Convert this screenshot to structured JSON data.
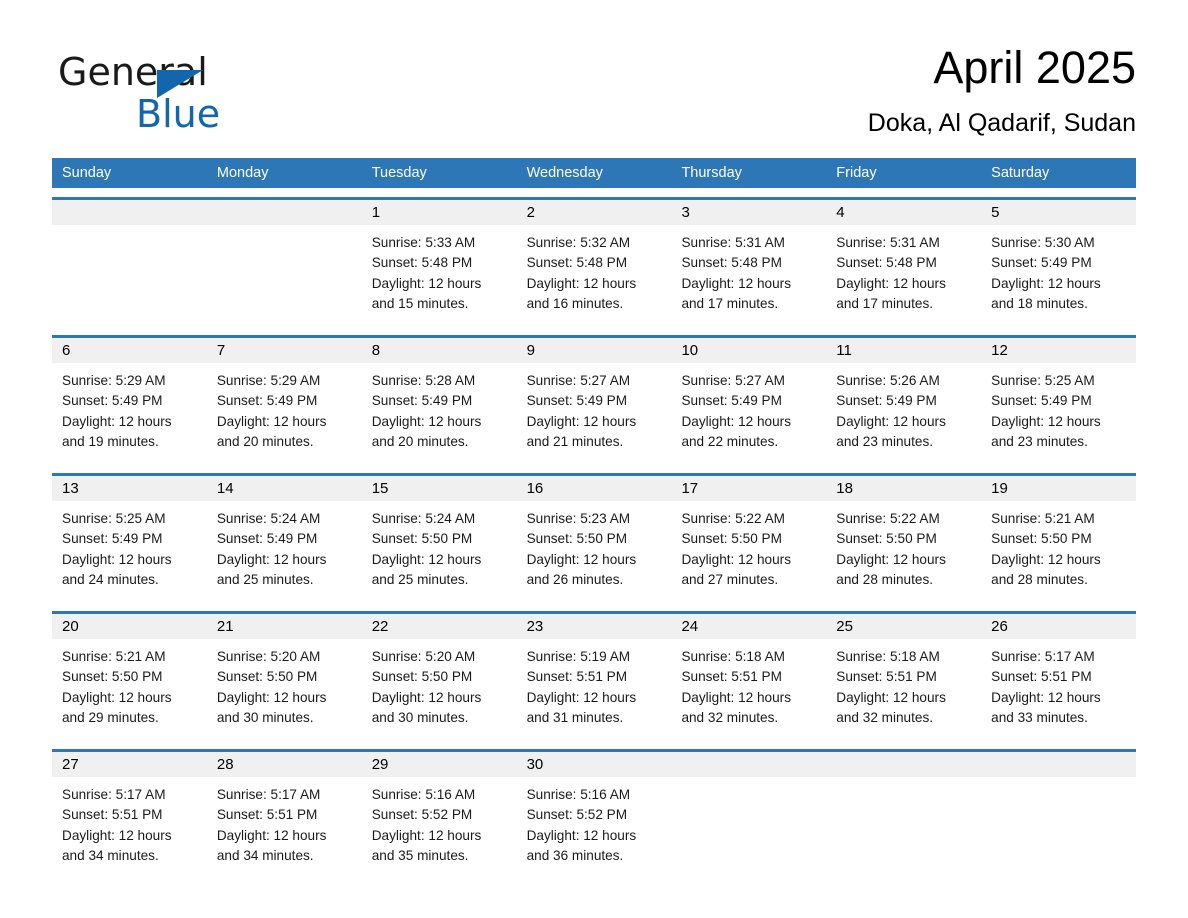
{
  "logo": {
    "word_one": "General",
    "word_two": "Blue",
    "triangle": "triangle-icon",
    "brand_color": "#1266ab"
  },
  "header": {
    "title": "April 2025",
    "subtitle": "Doka, Al Qadarif, Sudan"
  },
  "theme": {
    "header_blue": "#2e77b6",
    "row_divider_blue": "#2e77b6",
    "daynum_band": "#f0f0f0",
    "text": "#1a1a1a"
  },
  "weekdays": [
    "Sunday",
    "Monday",
    "Tuesday",
    "Wednesday",
    "Thursday",
    "Friday",
    "Saturday"
  ],
  "weeks": [
    {
      "days": [
        {
          "num": "",
          "sunrise": "",
          "sunset": "",
          "daylight_1": "",
          "daylight_2": ""
        },
        {
          "num": "",
          "sunrise": "",
          "sunset": "",
          "daylight_1": "",
          "daylight_2": ""
        },
        {
          "num": "1",
          "sunrise": "Sunrise: 5:33 AM",
          "sunset": "Sunset: 5:48 PM",
          "daylight_1": "Daylight: 12 hours",
          "daylight_2": "and 15 minutes."
        },
        {
          "num": "2",
          "sunrise": "Sunrise: 5:32 AM",
          "sunset": "Sunset: 5:48 PM",
          "daylight_1": "Daylight: 12 hours",
          "daylight_2": "and 16 minutes."
        },
        {
          "num": "3",
          "sunrise": "Sunrise: 5:31 AM",
          "sunset": "Sunset: 5:48 PM",
          "daylight_1": "Daylight: 12 hours",
          "daylight_2": "and 17 minutes."
        },
        {
          "num": "4",
          "sunrise": "Sunrise: 5:31 AM",
          "sunset": "Sunset: 5:48 PM",
          "daylight_1": "Daylight: 12 hours",
          "daylight_2": "and 17 minutes."
        },
        {
          "num": "5",
          "sunrise": "Sunrise: 5:30 AM",
          "sunset": "Sunset: 5:49 PM",
          "daylight_1": "Daylight: 12 hours",
          "daylight_2": "and 18 minutes."
        }
      ]
    },
    {
      "days": [
        {
          "num": "6",
          "sunrise": "Sunrise: 5:29 AM",
          "sunset": "Sunset: 5:49 PM",
          "daylight_1": "Daylight: 12 hours",
          "daylight_2": "and 19 minutes."
        },
        {
          "num": "7",
          "sunrise": "Sunrise: 5:29 AM",
          "sunset": "Sunset: 5:49 PM",
          "daylight_1": "Daylight: 12 hours",
          "daylight_2": "and 20 minutes."
        },
        {
          "num": "8",
          "sunrise": "Sunrise: 5:28 AM",
          "sunset": "Sunset: 5:49 PM",
          "daylight_1": "Daylight: 12 hours",
          "daylight_2": "and 20 minutes."
        },
        {
          "num": "9",
          "sunrise": "Sunrise: 5:27 AM",
          "sunset": "Sunset: 5:49 PM",
          "daylight_1": "Daylight: 12 hours",
          "daylight_2": "and 21 minutes."
        },
        {
          "num": "10",
          "sunrise": "Sunrise: 5:27 AM",
          "sunset": "Sunset: 5:49 PM",
          "daylight_1": "Daylight: 12 hours",
          "daylight_2": "and 22 minutes."
        },
        {
          "num": "11",
          "sunrise": "Sunrise: 5:26 AM",
          "sunset": "Sunset: 5:49 PM",
          "daylight_1": "Daylight: 12 hours",
          "daylight_2": "and 23 minutes."
        },
        {
          "num": "12",
          "sunrise": "Sunrise: 5:25 AM",
          "sunset": "Sunset: 5:49 PM",
          "daylight_1": "Daylight: 12 hours",
          "daylight_2": "and 23 minutes."
        }
      ]
    },
    {
      "days": [
        {
          "num": "13",
          "sunrise": "Sunrise: 5:25 AM",
          "sunset": "Sunset: 5:49 PM",
          "daylight_1": "Daylight: 12 hours",
          "daylight_2": "and 24 minutes."
        },
        {
          "num": "14",
          "sunrise": "Sunrise: 5:24 AM",
          "sunset": "Sunset: 5:49 PM",
          "daylight_1": "Daylight: 12 hours",
          "daylight_2": "and 25 minutes."
        },
        {
          "num": "15",
          "sunrise": "Sunrise: 5:24 AM",
          "sunset": "Sunset: 5:50 PM",
          "daylight_1": "Daylight: 12 hours",
          "daylight_2": "and 25 minutes."
        },
        {
          "num": "16",
          "sunrise": "Sunrise: 5:23 AM",
          "sunset": "Sunset: 5:50 PM",
          "daylight_1": "Daylight: 12 hours",
          "daylight_2": "and 26 minutes."
        },
        {
          "num": "17",
          "sunrise": "Sunrise: 5:22 AM",
          "sunset": "Sunset: 5:50 PM",
          "daylight_1": "Daylight: 12 hours",
          "daylight_2": "and 27 minutes."
        },
        {
          "num": "18",
          "sunrise": "Sunrise: 5:22 AM",
          "sunset": "Sunset: 5:50 PM",
          "daylight_1": "Daylight: 12 hours",
          "daylight_2": "and 28 minutes."
        },
        {
          "num": "19",
          "sunrise": "Sunrise: 5:21 AM",
          "sunset": "Sunset: 5:50 PM",
          "daylight_1": "Daylight: 12 hours",
          "daylight_2": "and 28 minutes."
        }
      ]
    },
    {
      "days": [
        {
          "num": "20",
          "sunrise": "Sunrise: 5:21 AM",
          "sunset": "Sunset: 5:50 PM",
          "daylight_1": "Daylight: 12 hours",
          "daylight_2": "and 29 minutes."
        },
        {
          "num": "21",
          "sunrise": "Sunrise: 5:20 AM",
          "sunset": "Sunset: 5:50 PM",
          "daylight_1": "Daylight: 12 hours",
          "daylight_2": "and 30 minutes."
        },
        {
          "num": "22",
          "sunrise": "Sunrise: 5:20 AM",
          "sunset": "Sunset: 5:50 PM",
          "daylight_1": "Daylight: 12 hours",
          "daylight_2": "and 30 minutes."
        },
        {
          "num": "23",
          "sunrise": "Sunrise: 5:19 AM",
          "sunset": "Sunset: 5:51 PM",
          "daylight_1": "Daylight: 12 hours",
          "daylight_2": "and 31 minutes."
        },
        {
          "num": "24",
          "sunrise": "Sunrise: 5:18 AM",
          "sunset": "Sunset: 5:51 PM",
          "daylight_1": "Daylight: 12 hours",
          "daylight_2": "and 32 minutes."
        },
        {
          "num": "25",
          "sunrise": "Sunrise: 5:18 AM",
          "sunset": "Sunset: 5:51 PM",
          "daylight_1": "Daylight: 12 hours",
          "daylight_2": "and 32 minutes."
        },
        {
          "num": "26",
          "sunrise": "Sunrise: 5:17 AM",
          "sunset": "Sunset: 5:51 PM",
          "daylight_1": "Daylight: 12 hours",
          "daylight_2": "and 33 minutes."
        }
      ]
    },
    {
      "days": [
        {
          "num": "27",
          "sunrise": "Sunrise: 5:17 AM",
          "sunset": "Sunset: 5:51 PM",
          "daylight_1": "Daylight: 12 hours",
          "daylight_2": "and 34 minutes."
        },
        {
          "num": "28",
          "sunrise": "Sunrise: 5:17 AM",
          "sunset": "Sunset: 5:51 PM",
          "daylight_1": "Daylight: 12 hours",
          "daylight_2": "and 34 minutes."
        },
        {
          "num": "29",
          "sunrise": "Sunrise: 5:16 AM",
          "sunset": "Sunset: 5:52 PM",
          "daylight_1": "Daylight: 12 hours",
          "daylight_2": "and 35 minutes."
        },
        {
          "num": "30",
          "sunrise": "Sunrise: 5:16 AM",
          "sunset": "Sunset: 5:52 PM",
          "daylight_1": "Daylight: 12 hours",
          "daylight_2": "and 36 minutes."
        },
        {
          "num": "",
          "sunrise": "",
          "sunset": "",
          "daylight_1": "",
          "daylight_2": ""
        },
        {
          "num": "",
          "sunrise": "",
          "sunset": "",
          "daylight_1": "",
          "daylight_2": ""
        },
        {
          "num": "",
          "sunrise": "",
          "sunset": "",
          "daylight_1": "",
          "daylight_2": ""
        }
      ]
    }
  ]
}
